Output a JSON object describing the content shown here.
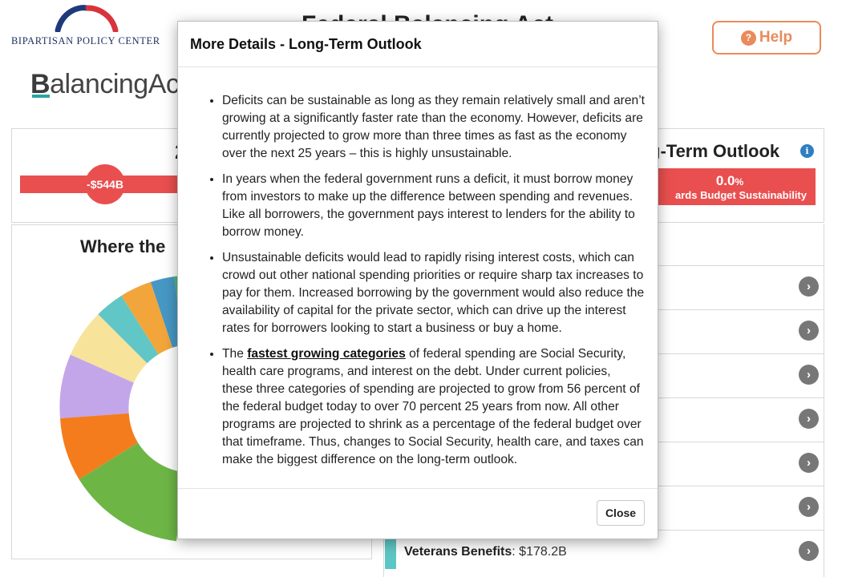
{
  "header": {
    "org_name": "Bipartisan Policy Center",
    "page_title": "Federal Balancing Act",
    "help_label": "Help",
    "app_logo_first": "B",
    "app_logo_rest": "alancingAct"
  },
  "summary": {
    "year_fragment": "2",
    "deficit_value": "-$544B"
  },
  "spending": {
    "title_fragment": "Where the"
  },
  "outlook": {
    "title_fragment": "g-Term Outlook",
    "value": "0.0",
    "value_unit": "%",
    "subtitle_fragment": "ards Budget Sustainability"
  },
  "categories_list": {
    "visible_item": {
      "name": "Veterans Benefits",
      "value": ": $178.2B"
    }
  },
  "modal": {
    "title": "More Details - Long-Term Outlook",
    "bullets": [
      "Deficits can be sustainable as long as they remain relatively small and aren’t growing at a significantly faster rate than the economy. However, deficits are currently projected to grow more than three times as fast as the economy over the next 25 years – this is highly unsustainable.",
      "In years when the federal government runs a deficit, it must borrow money from investors to make up the difference between spending and revenues. Like all borrowers, the government pays interest to lenders for the ability to borrow money.",
      "Unsustainable deficits would lead to rapidly rising interest costs, which can crowd out other national spending priorities or require sharp tax increases to pay for them. Increased borrowing by the government would also reduce the availability of capital for the private sector, which can drive up the interest rates for borrowers looking to start a business or buy a home."
    ],
    "bullet4_prefix": "The ",
    "bullet4_link": "fastest growing categories",
    "bullet4_rest": " of federal spending are Social Security, health care programs, and interest on the debt. Under current policies, these three categories of spending are projected to grow from 56 percent of the federal budget today to over 70 percent 25 years from now. All other programs are projected to shrink as a percentage of the federal budget over that timeframe. Thus, changes to Social Security, health care, and taxes can make the biggest difference on the long-term outlook.",
    "close_label": "Close"
  },
  "icons": {
    "help": "lightbulb-icon",
    "info": "info-icon",
    "row_expand": "chevron-right-icon"
  },
  "colors": {
    "accent_orange": "#e98b5b",
    "deficit_red": "#e94f4f",
    "teal": "#2aa3a8",
    "veterans": "#5cc6c4"
  }
}
